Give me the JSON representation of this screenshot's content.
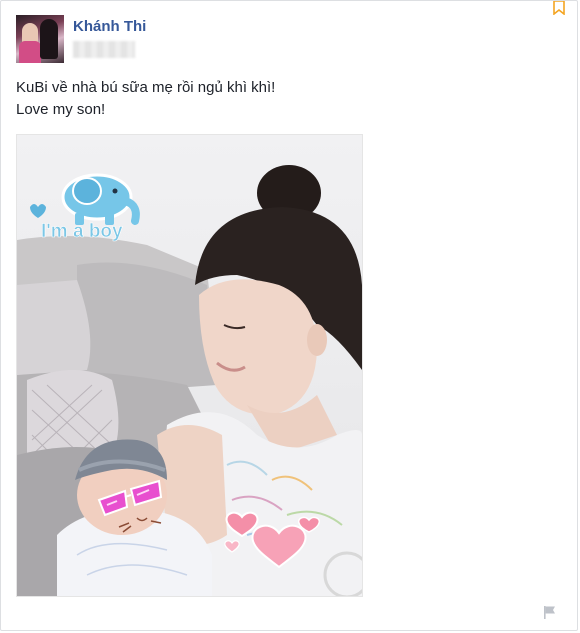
{
  "post": {
    "author_name": "Khánh Thi",
    "text_lines": [
      "KuBi về nhà bú sữa mẹ rồi ngủ khì khì!",
      "Love my son!"
    ],
    "photo": {
      "sticker_text": "I'm a boy"
    }
  },
  "icons": {
    "corner": "bookmark-ribbon-icon",
    "report": "flag-icon"
  },
  "colors": {
    "author_link": "#365899",
    "text": "#1d2129",
    "border": "#dddfe2",
    "ribbon": "#f4a522"
  }
}
